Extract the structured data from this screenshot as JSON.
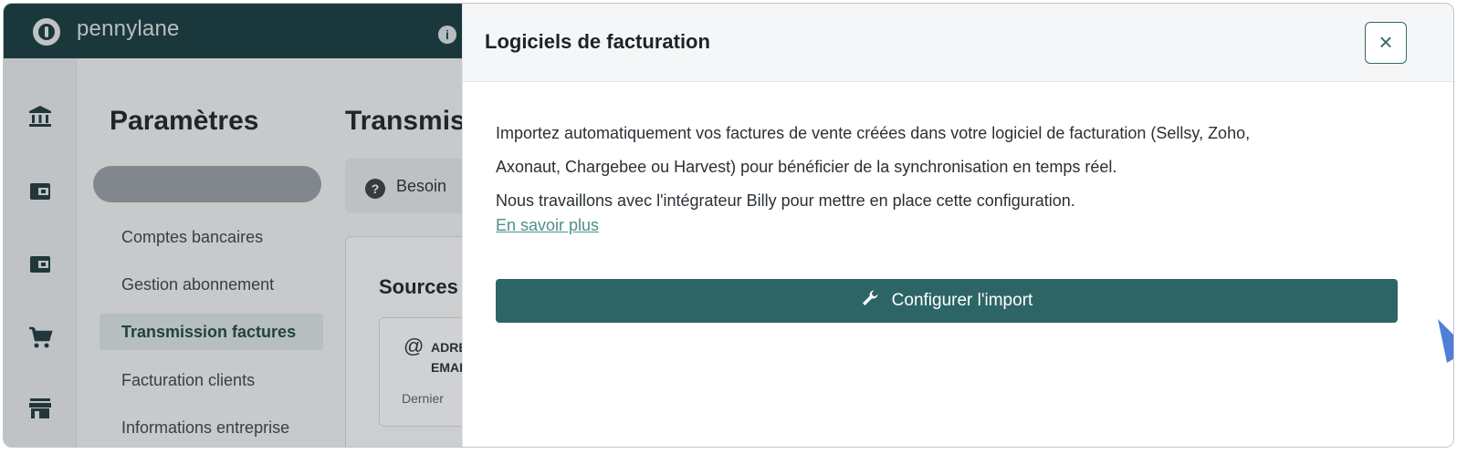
{
  "app": {
    "brand": "pennylane",
    "icons": [
      "pennylane-logo-icon",
      "info-icon",
      "bank-icon",
      "wallet-icon",
      "wallet-icon",
      "cart-icon",
      "store-icon"
    ]
  },
  "settings": {
    "title": "Paramètres",
    "items": [
      {
        "label": "Comptes bancaires"
      },
      {
        "label": "Gestion abonnement"
      },
      {
        "label": "Transmission factures"
      },
      {
        "label": "Facturation clients"
      },
      {
        "label": "Informations entreprise"
      }
    ]
  },
  "main": {
    "title": "Transmission",
    "help": "Besoin",
    "sources_title": "Sources",
    "email_line1": "ADRESSE",
    "email_line2": "EMAIL",
    "last_label": "Dernier"
  },
  "modal": {
    "title": "Logiciels de facturation",
    "close_symbol": "×",
    "description_lines": [
      "Importez automatiquement vos factures de vente créées dans votre logiciel de facturation (Sellsy, Zoho,",
      "Axonaut, Chargebee ou Harvest) pour bénéficier de la synchronisation en temps réel.",
      "Nous travaillons avec l'intégrateur Billy pour mettre en place cette configuration."
    ],
    "link": "En savoir plus",
    "button_label": "Configurer l'import",
    "accent_color": "#2d6566",
    "annotation_arrow_color": "#4f7fd6"
  }
}
